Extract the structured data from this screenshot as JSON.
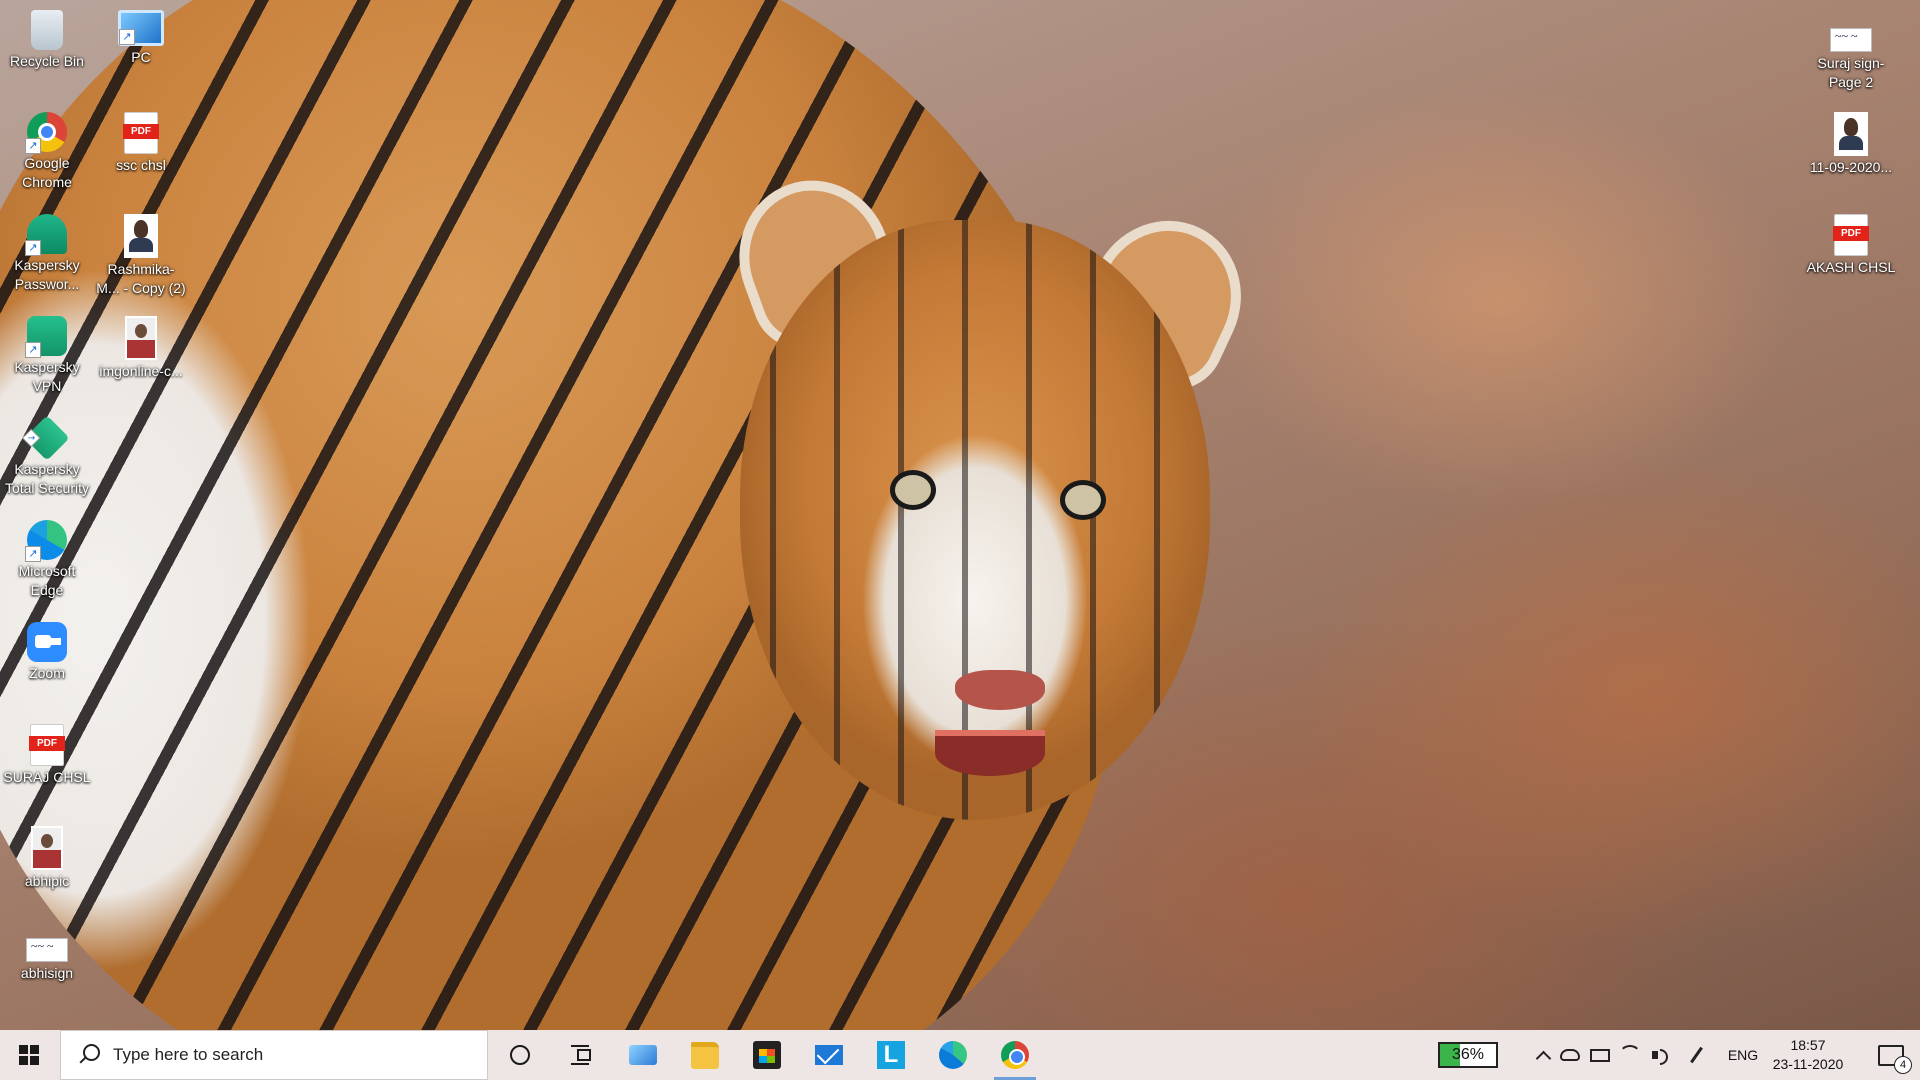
{
  "desktop": {
    "wallpaper": "tiger-wallpaper",
    "icons_left": [
      {
        "label": "Recycle Bin",
        "icon": "recycle-bin-icon"
      },
      {
        "label": "PC",
        "icon": "pc-icon"
      },
      {
        "label": "Google Chrome",
        "icon": "chrome-icon"
      },
      {
        "label": "ssc chsl",
        "icon": "pdf-icon"
      },
      {
        "label": "Kaspersky Passwor...",
        "icon": "kaspersky-password-icon"
      },
      {
        "label": "Rashmika-M... - Copy (2)",
        "icon": "image-icon"
      },
      {
        "label": "Kaspersky VPN",
        "icon": "kaspersky-vpn-icon"
      },
      {
        "label": "imgonline-c...",
        "icon": "image-icon"
      },
      {
        "label": "Kaspersky Total Security",
        "icon": "kaspersky-total-security-icon"
      },
      {
        "label": "Microsoft Edge",
        "icon": "edge-icon"
      },
      {
        "label": "Zoom",
        "icon": "zoom-icon"
      },
      {
        "label": "SURAJ CHSL",
        "icon": "pdf-icon"
      },
      {
        "label": "abhipic",
        "icon": "image-icon"
      },
      {
        "label": "abhisign",
        "icon": "image-icon"
      }
    ],
    "icons_right": [
      {
        "label": "Suraj sign-Page 2",
        "icon": "image-icon"
      },
      {
        "label": "11-09-2020...",
        "icon": "image-icon"
      },
      {
        "label": "AKASH CHSL",
        "icon": "pdf-icon"
      }
    ]
  },
  "taskbar": {
    "search_placeholder": "Type here to search",
    "pinned_apps": [
      "control-panel-icon",
      "file-explorer-icon",
      "microsoft-store-icon",
      "mail-icon",
      "l-app-icon",
      "edge-icon",
      "chrome-icon"
    ],
    "l_app_letter": "L",
    "battery_text": "36%",
    "battery_level": 36,
    "language": "ENG",
    "time": "18:57",
    "date": "23-11-2020",
    "notification_count": "4",
    "colors": {
      "battery_fill": "#3bb54a",
      "running_indicator": "#6f9fd8"
    }
  }
}
